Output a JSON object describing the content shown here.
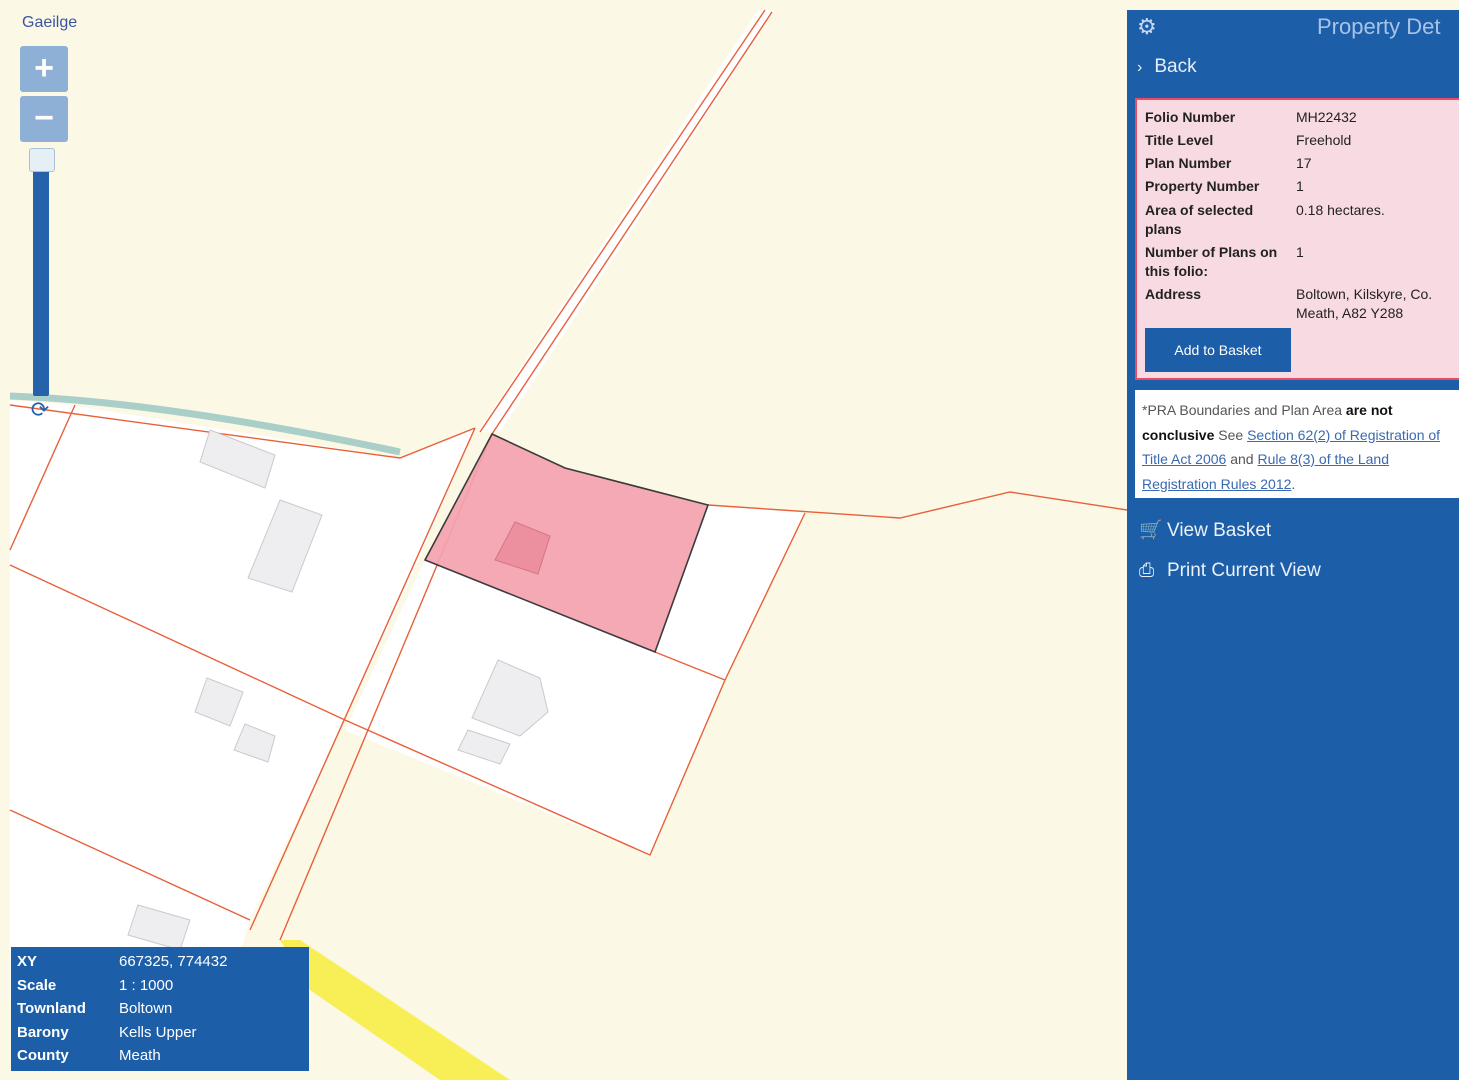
{
  "language_link": "Gaeilge",
  "zoom": {
    "in_label": "+",
    "out_label": "−"
  },
  "info_box": [
    {
      "key": "XY",
      "value": "667325, 774432"
    },
    {
      "key": "Scale",
      "value": "1 : 1000"
    },
    {
      "key": "Townland",
      "value": "Boltown"
    },
    {
      "key": "Barony",
      "value": "Kells Upper"
    },
    {
      "key": "County",
      "value": "Meath"
    }
  ],
  "panel": {
    "title": "Property Det",
    "back_label": "Back",
    "details": {
      "folio_number_label": "Folio Number",
      "folio_number": "MH22432",
      "title_level_label": "Title Level",
      "title_level": "Freehold",
      "plan_number_label": "Plan Number",
      "plan_number": "17",
      "property_number_label": "Property Number",
      "property_number": "1",
      "area_label": "Area of selected plans",
      "area": "0.18 hectares.",
      "num_plans_label": "Number of Plans on this folio:",
      "num_plans": "1",
      "address_label": "Address",
      "address": "Boltown, Kilskyre, Co. Meath, A82 Y288"
    },
    "add_to_basket": "Add to Basket",
    "disclaimer": {
      "prefix": "*PRA Boundaries and Plan Area ",
      "bold": "are not conclusive",
      "see": " See ",
      "link1": "Section 62(2) of Registration of Title Act 2006",
      "and": " and ",
      "link2": "Rule 8(3) of the Land Registration Rules 2012",
      "end": "."
    },
    "view_basket": "View Basket",
    "print_view": "Print Current View"
  },
  "colors": {
    "panel_blue": "#1d5ea8",
    "selected_parcel": "#f4a3b0",
    "boundary": "#e8603a",
    "map_bg": "#fbf9e6"
  }
}
